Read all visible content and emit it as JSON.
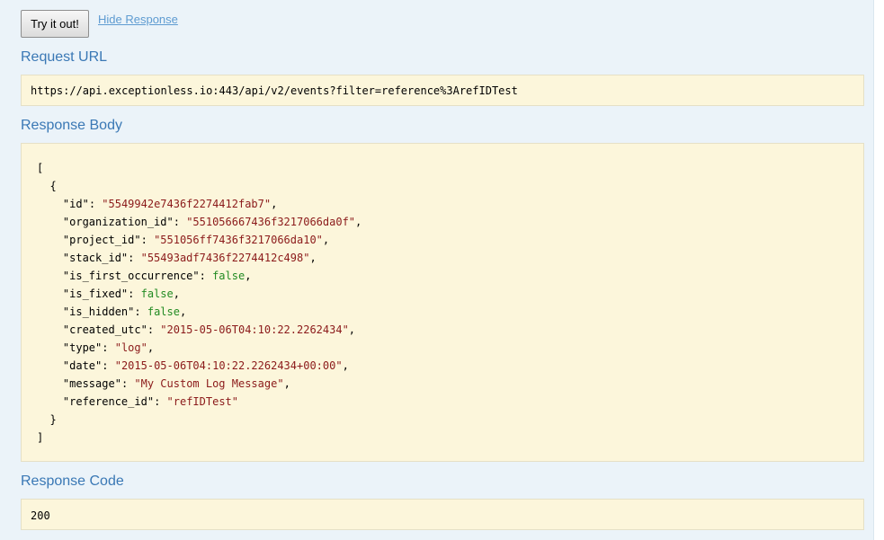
{
  "actions": {
    "try_label": "Try it out!",
    "hide_label": "Hide Response"
  },
  "request_url": {
    "title": "Request URL",
    "value": "https://api.exceptionless.io:443/api/v2/events?filter=reference%3ArefIDTest"
  },
  "response_body": {
    "title": "Response Body",
    "open_array": "[",
    "open_object": "{",
    "close_object": "}",
    "close_array": "]",
    "fields": [
      {
        "key": "\"id\"",
        "value": "\"5549942e7436f2274412fab7\"",
        "type": "string",
        "comma": ","
      },
      {
        "key": "\"organization_id\"",
        "value": "\"551056667436f3217066da0f\"",
        "type": "string",
        "comma": ","
      },
      {
        "key": "\"project_id\"",
        "value": "\"551056ff7436f3217066da10\"",
        "type": "string",
        "comma": ","
      },
      {
        "key": "\"stack_id\"",
        "value": "\"55493adf7436f2274412c498\"",
        "type": "string",
        "comma": ","
      },
      {
        "key": "\"is_first_occurrence\"",
        "value": "false",
        "type": "boolean",
        "comma": ","
      },
      {
        "key": "\"is_fixed\"",
        "value": "false",
        "type": "boolean",
        "comma": ","
      },
      {
        "key": "\"is_hidden\"",
        "value": "false",
        "type": "boolean",
        "comma": ","
      },
      {
        "key": "\"created_utc\"",
        "value": "\"2015-05-06T04:10:22.2262434\"",
        "type": "string",
        "comma": ","
      },
      {
        "key": "\"type\"",
        "value": "\"log\"",
        "type": "string",
        "comma": ","
      },
      {
        "key": "\"date\"",
        "value": "\"2015-05-06T04:10:22.2262434+00:00\"",
        "type": "string",
        "comma": ","
      },
      {
        "key": "\"message\"",
        "value": "\"My Custom Log Message\"",
        "type": "string",
        "comma": ","
      },
      {
        "key": "\"reference_id\"",
        "value": "\"refIDTest\"",
        "type": "string",
        "comma": ""
      }
    ]
  },
  "response_code": {
    "title": "Response Code",
    "value": "200"
  },
  "colors": {
    "panel_bg": "#ebf3f9",
    "block_bg": "#fcf6db",
    "title": "#3a78b5",
    "link": "#5e9bd1",
    "string_value": "#8b1a1a",
    "boolean_value": "#228b22"
  }
}
